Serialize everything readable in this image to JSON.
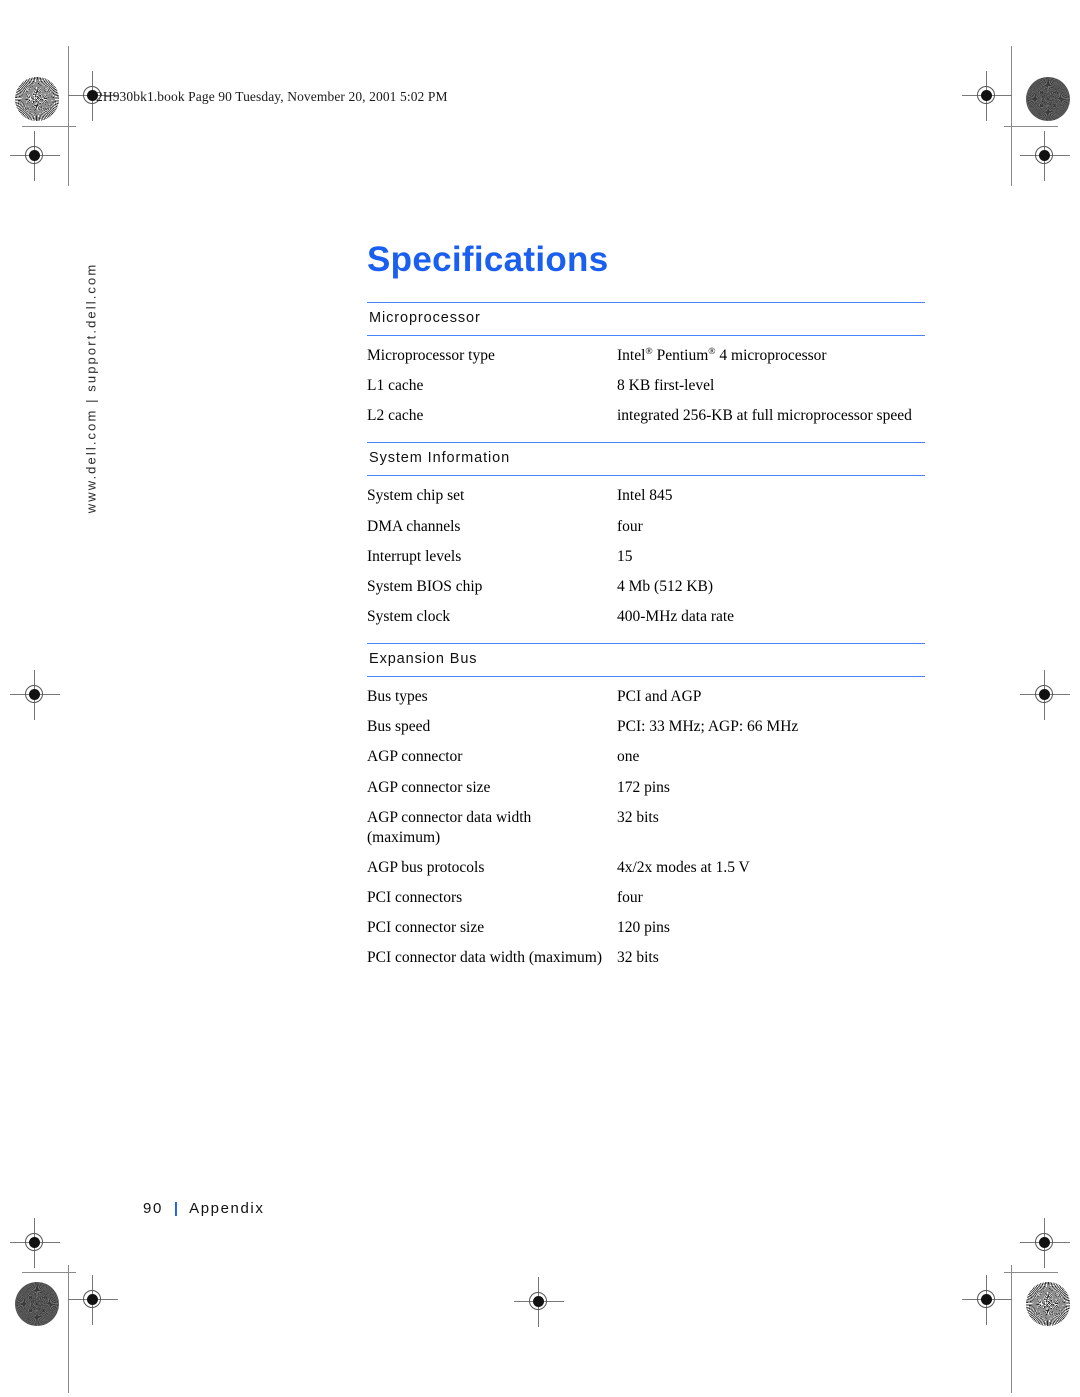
{
  "print_header": {
    "text": "2H930bk1.book  Page 90  Tuesday, November 20, 2001  5:02 PM"
  },
  "side_rail": {
    "text": "www.dell.com | support.dell.com"
  },
  "page": {
    "title": "Specifications"
  },
  "footer": {
    "page_number": "90",
    "separator": "|",
    "section_name": "Appendix"
  },
  "colors": {
    "title_blue": "#1A5FF0",
    "rule_blue": "#4884F5",
    "text_black": "#000000"
  },
  "spec_sections": [
    {
      "heading": "Microprocessor",
      "rows": [
        {
          "label": "Microprocessor type",
          "value_html": "Intel<sup>&#174;</sup> Pentium<sup>&#174;</sup> 4 microprocessor"
        },
        {
          "label": "L1 cache",
          "value_html": "8 KB first-level"
        },
        {
          "label": "L2 cache",
          "value_html": "integrated 256-KB at full microprocessor speed"
        }
      ]
    },
    {
      "heading": "System Information",
      "rows": [
        {
          "label": "System chip set",
          "value_html": "Intel 845"
        },
        {
          "label": "DMA channels",
          "value_html": "four"
        },
        {
          "label": "Interrupt levels",
          "value_html": "15"
        },
        {
          "label": "System BIOS chip",
          "value_html": "4 Mb (512 KB)"
        },
        {
          "label": "System clock",
          "value_html": "400-MHz data rate"
        }
      ]
    },
    {
      "heading": "Expansion Bus",
      "rows": [
        {
          "label": "Bus types",
          "value_html": "PCI and AGP"
        },
        {
          "label": "Bus speed",
          "value_html": "PCI: 33 MHz; AGP: 66 MHz"
        },
        {
          "label": "AGP connector",
          "value_html": "one"
        },
        {
          "label": "AGP connector size",
          "value_html": "172 pins"
        },
        {
          "label": "AGP connector data width (maximum)",
          "value_html": "32 bits"
        },
        {
          "label": "AGP bus protocols",
          "value_html": "4x/2x modes at 1.5 V"
        },
        {
          "label": "PCI connectors",
          "value_html": "four"
        },
        {
          "label": "PCI connector size",
          "value_html": "120 pins"
        },
        {
          "label": "PCI connector data width (maximum)",
          "value_html": "32 bits"
        }
      ]
    }
  ]
}
